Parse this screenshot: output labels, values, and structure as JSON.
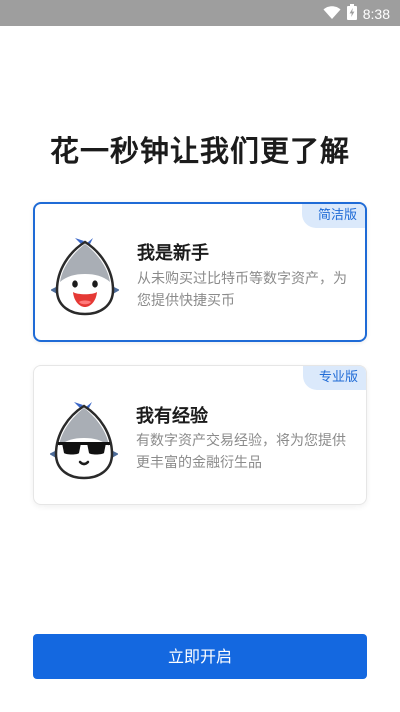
{
  "status_bar": {
    "time": "8:38",
    "icons": [
      "wifi-icon",
      "battery-charging-icon"
    ]
  },
  "page": {
    "title": "花一秒钟让我们更了解"
  },
  "options": [
    {
      "badge": "简洁版",
      "title": "我是新手",
      "description": "从未购买过比特币等数字资产，为您提供快捷买币",
      "selected": true,
      "icon": "smiling-mascot-icon"
    },
    {
      "badge": "专业版",
      "title": "我有经验",
      "description": "有数字资产交易经验，将为您提供更丰富的金融衍生品",
      "selected": false,
      "icon": "sunglasses-mascot-icon"
    }
  ],
  "actions": {
    "start_label": "立即开启"
  },
  "colors": {
    "accent": "#1468e0",
    "badge_bg": "#dbe9fb",
    "status_bar": "#9e9e9e"
  }
}
